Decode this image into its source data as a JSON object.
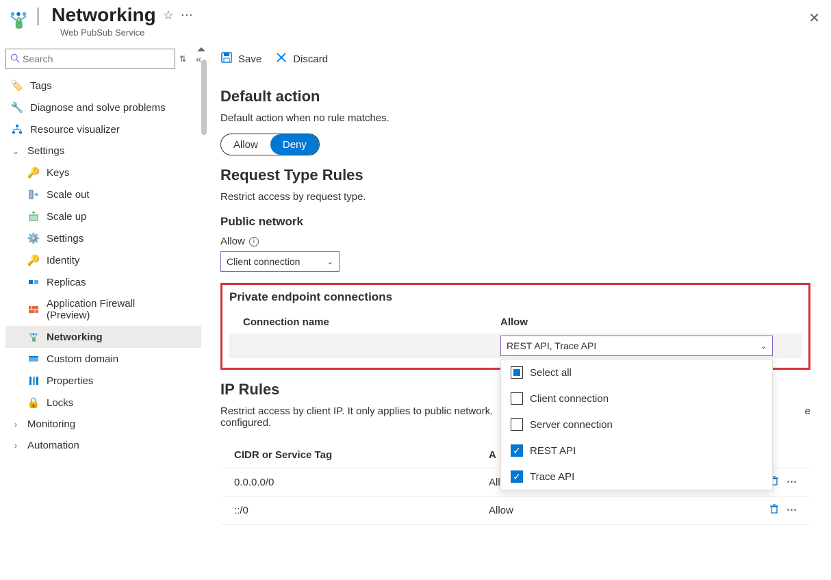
{
  "header": {
    "title": "Networking",
    "subtitle": "Web PubSub Service"
  },
  "search": {
    "placeholder": "Search"
  },
  "sidebar": {
    "tags": "Tags",
    "diagnose": "Diagnose and solve problems",
    "resource_viz": "Resource visualizer",
    "settings_group": "Settings",
    "keys": "Keys",
    "scale_out": "Scale out",
    "scale_up": "Scale up",
    "settings": "Settings",
    "identity": "Identity",
    "replicas": "Replicas",
    "app_firewall": "Application Firewall (Preview)",
    "networking": "Networking",
    "custom_domain": "Custom domain",
    "properties": "Properties",
    "locks": "Locks",
    "monitoring": "Monitoring",
    "automation": "Automation"
  },
  "toolbar": {
    "save": "Save",
    "discard": "Discard"
  },
  "default_action": {
    "heading": "Default action",
    "desc": "Default action when no rule matches.",
    "allow": "Allow",
    "deny": "Deny"
  },
  "request_rules": {
    "heading": "Request Type Rules",
    "desc": "Restrict access by request type.",
    "public_network": "Public network",
    "allow_label": "Allow",
    "allow_value": "Client connection"
  },
  "private_ep": {
    "heading": "Private endpoint connections",
    "col_name": "Connection name",
    "col_allow": "Allow",
    "selected": "REST API, Trace API",
    "opt_select_all": "Select all",
    "opt_client": "Client connection",
    "opt_server": "Server connection",
    "opt_rest": "REST API",
    "opt_trace": "Trace API"
  },
  "ip_rules": {
    "heading": "IP Rules",
    "desc_part": "Restrict access by client IP. It only applies to public network.",
    "desc_cut": "e",
    "configured": "configured.",
    "col_cidr": "CIDR or Service Tag",
    "col_action_cut": "A",
    "row1_cidr": "0.0.0.0/0",
    "row1_action": "Allow",
    "row2_cidr": "::/0",
    "row2_action": "Allow"
  }
}
